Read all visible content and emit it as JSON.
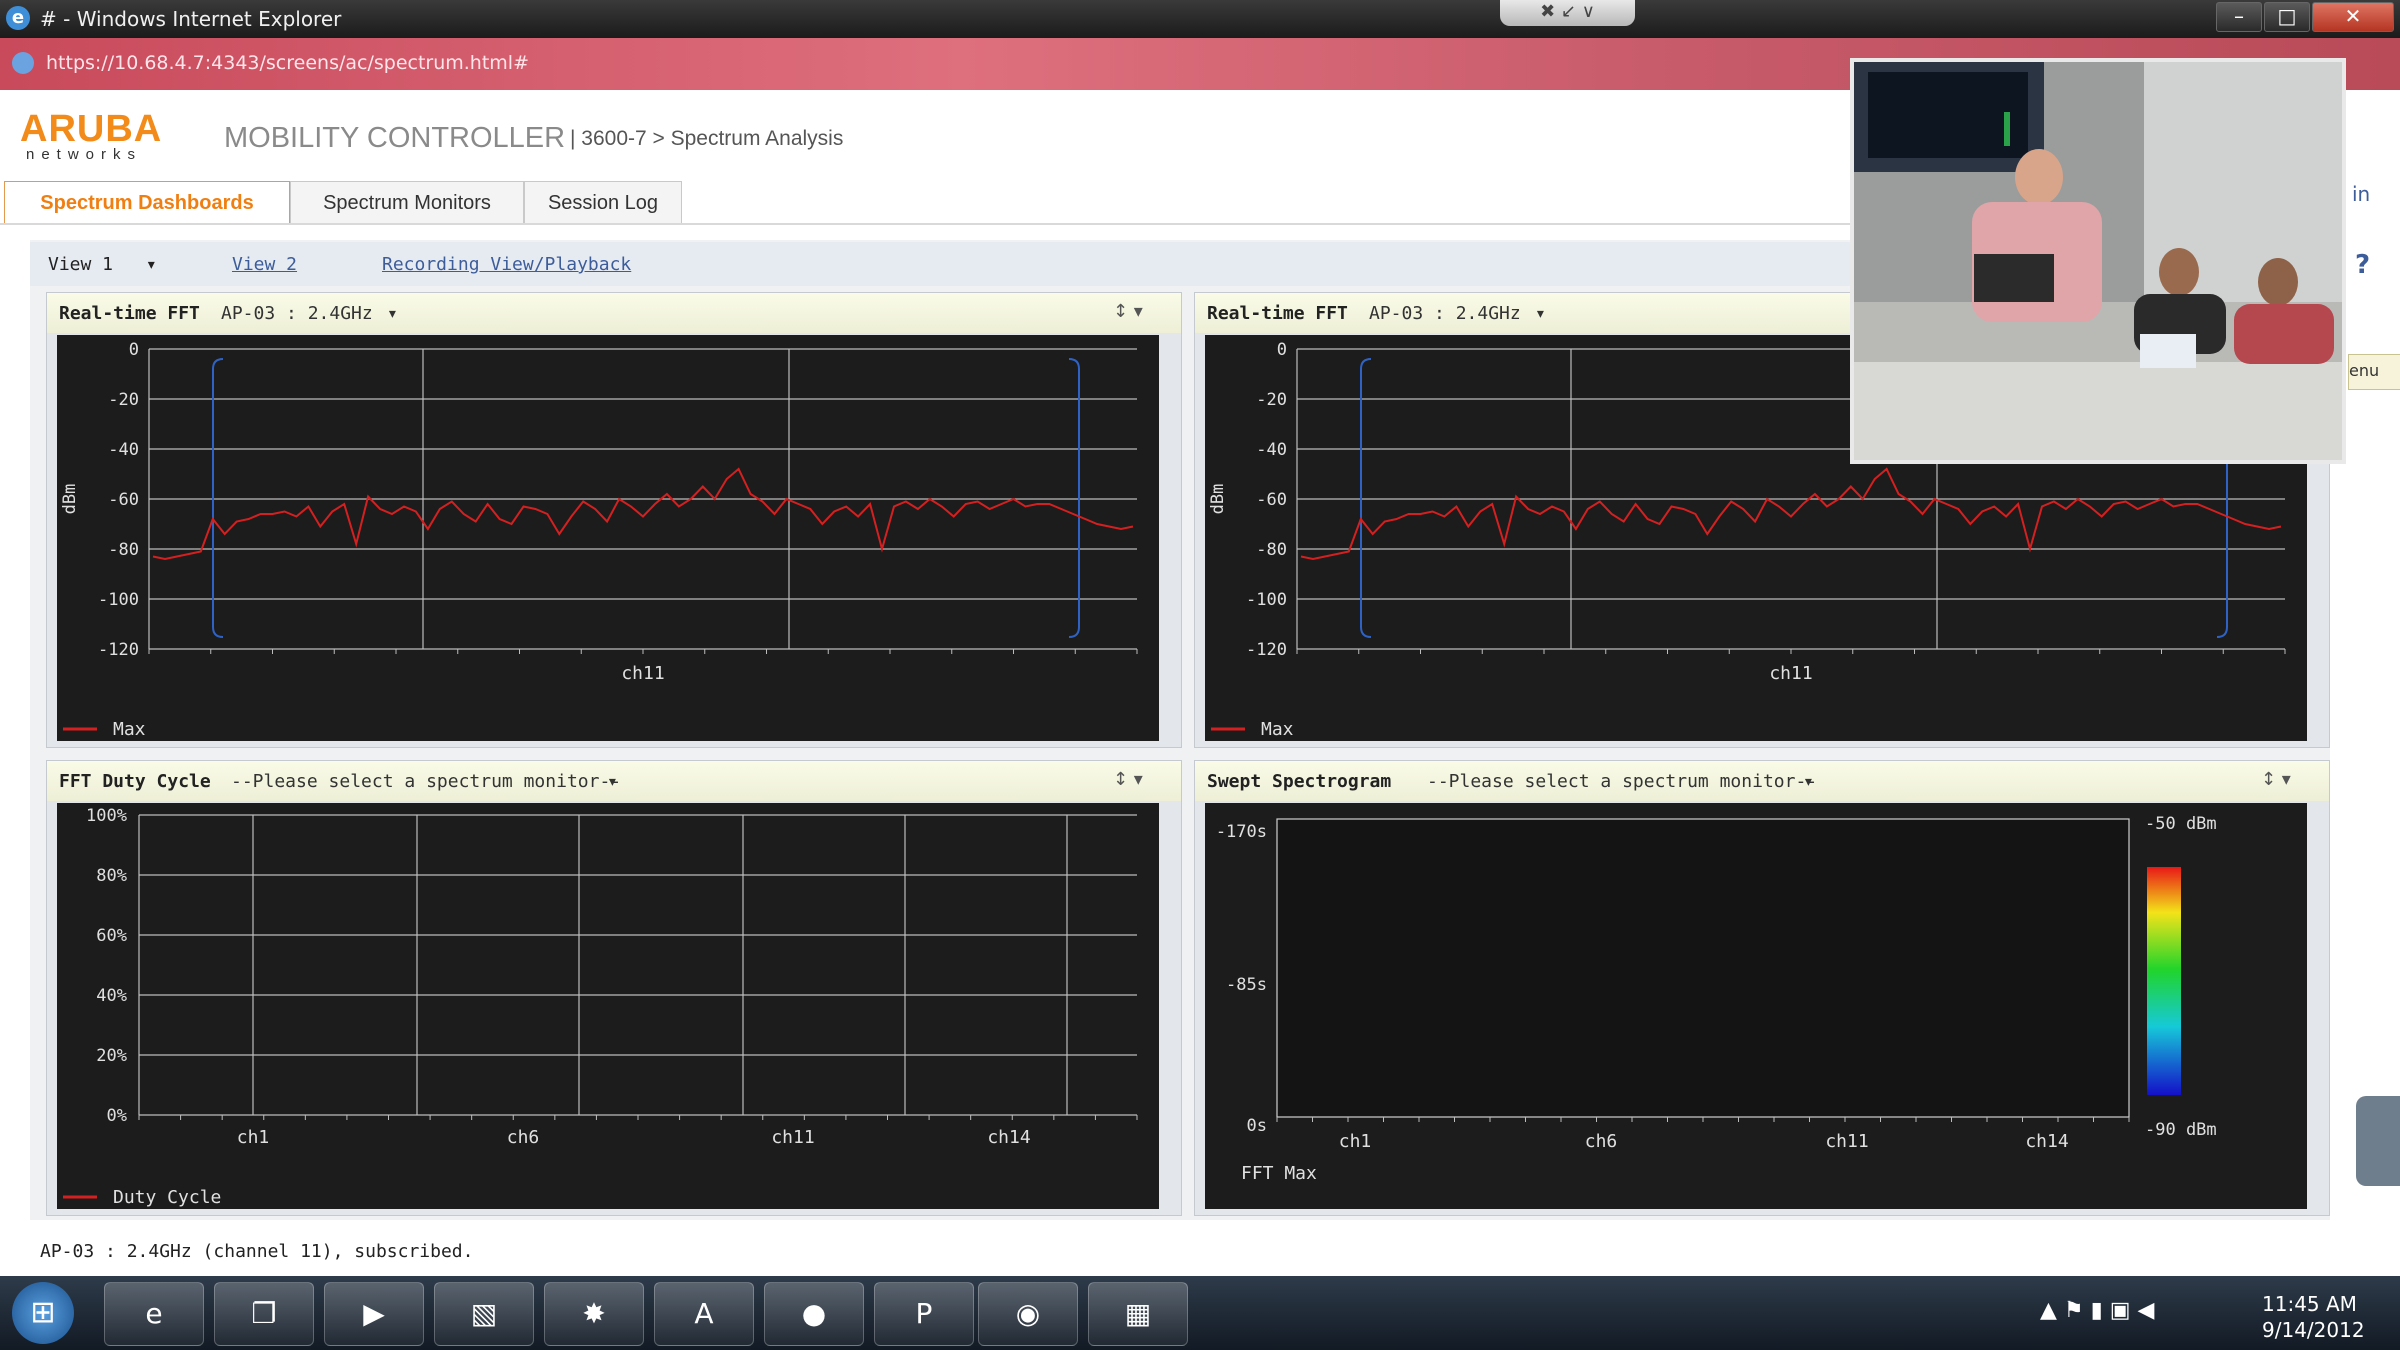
{
  "window": {
    "title": "# - Windows Internet Explorer",
    "minimize": "–",
    "maximize": "□",
    "close": "✕",
    "top_tab_icons": "✖ ↙ ∨"
  },
  "address": {
    "url": "https://10.68.4.7:4343/screens/ac/spectrum.html#"
  },
  "header": {
    "logo_main": "ARUBA",
    "logo_sub": "networks",
    "product": "MOBILITY CONTROLLER",
    "breadcrumb": "| 3600-7 > Spectrum Analysis"
  },
  "tabs": [
    {
      "label": "Spectrum Dashboards",
      "active": true
    },
    {
      "label": "Spectrum Monitors",
      "active": false
    },
    {
      "label": "Session Log",
      "active": false
    }
  ],
  "views": {
    "current": "View 1",
    "dropdown": "▾",
    "view2": "View 2",
    "recording": "Recording View/Playback",
    "help": "?"
  },
  "side": {
    "login_fragment": "in",
    "menu_fragment": "enu"
  },
  "panels": {
    "fft_left": {
      "title": "Real-time FFT",
      "monitor": "AP-03 : 2.4GHz",
      "dropdown": "▾",
      "ctrl": "↕  ▾"
    },
    "fft_right": {
      "title": "Real-time FFT",
      "monitor": "AP-03 : 2.4GHz",
      "dropdown": "▾",
      "ctrl": "↕  ▾"
    },
    "duty": {
      "title": "FFT Duty Cycle",
      "monitor": "--Please select a spectrum monitor--",
      "dropdown": "▾",
      "ctrl": "↕  ▾"
    },
    "spectro": {
      "title": "Swept Spectrogram",
      "monitor": "--Please select a spectrum monitor--",
      "dropdown": "▾",
      "ctrl": "↕  ▾"
    }
  },
  "chart_data": [
    {
      "type": "line",
      "ylabel": "dBm",
      "xlabel": "ch11",
      "ylim": [
        -120,
        0
      ],
      "y_ticks": [
        "0",
        "-20",
        "-40",
        "-60",
        "-80",
        "-100",
        "-120"
      ],
      "legend": "Max",
      "series": [
        {
          "name": "Max",
          "color": "#d42020",
          "values": [
            -83,
            -84,
            -83,
            -82,
            -81,
            -68,
            -74,
            -69,
            -68,
            -66,
            -66,
            -65,
            -67,
            -63,
            -71,
            -65,
            -62,
            -78,
            -59,
            -64,
            -66,
            -63,
            -65,
            -72,
            -64,
            -61,
            -66,
            -69,
            -62,
            -68,
            -70,
            -63,
            -64,
            -66,
            -74,
            -67,
            -61,
            -64,
            -69,
            -60,
            -63,
            -67,
            -62,
            -58,
            -63,
            -60,
            -55,
            -60,
            -52,
            -48,
            -58,
            -61,
            -66,
            -60,
            -62,
            -64,
            -70,
            -65,
            -63,
            -67,
            -62,
            -80,
            -63,
            -61,
            -64,
            -60,
            -63,
            -67,
            -62,
            -61,
            -64,
            -62,
            -60,
            -63,
            -62,
            -62,
            -64,
            -66,
            -68,
            -70,
            -71,
            -72,
            -71
          ]
        }
      ]
    },
    {
      "type": "line",
      "ylabel": "dBm",
      "xlabel": "ch11",
      "ylim": [
        -120,
        0
      ],
      "y_ticks": [
        "0",
        "-20",
        "-40",
        "-60",
        "-80",
        "-100",
        "-120"
      ],
      "legend": "Max",
      "series": [
        {
          "name": "Max",
          "color": "#d42020",
          "values": [
            -83,
            -84,
            -83,
            -82,
            -81,
            -68,
            -74,
            -69,
            -68,
            -66,
            -66,
            -65,
            -67,
            -63,
            -71,
            -65,
            -62,
            -78,
            -59,
            -64,
            -66,
            -63,
            -65,
            -72,
            -64,
            -61,
            -66,
            -69,
            -62,
            -68,
            -70,
            -63,
            -64,
            -66,
            -74,
            -67,
            -61,
            -64,
            -69,
            -60,
            -63,
            -67,
            -62,
            -58,
            -63,
            -60,
            -55,
            -60,
            -52,
            -48,
            -58,
            -61,
            -66,
            -60,
            -62,
            -64,
            -70,
            -65,
            -63,
            -67,
            -62,
            -80,
            -63,
            -61,
            -64,
            -60,
            -63,
            -67,
            -62,
            -61,
            -64,
            -62,
            -60,
            -63,
            -62,
            -62,
            -64,
            -66,
            -68,
            -70,
            -71,
            -72,
            -71
          ]
        }
      ]
    },
    {
      "type": "line",
      "ylim": [
        0,
        100
      ],
      "y_ticks": [
        "100%",
        "80%",
        "60%",
        "40%",
        "20%",
        "0%"
      ],
      "x_ticks": [
        "ch1",
        "ch6",
        "ch11",
        "ch14"
      ],
      "legend": "Duty Cycle",
      "series": [
        {
          "name": "Duty Cycle",
          "color": "#d42020",
          "values": []
        }
      ]
    },
    {
      "type": "heatmap",
      "y_ticks": [
        "-170s",
        "-85s",
        "0s"
      ],
      "x_ticks": [
        "ch1",
        "ch6",
        "ch11",
        "ch14"
      ],
      "scale_labels": [
        "-50 dBm",
        "-90 dBm"
      ],
      "footer": "FFT Max",
      "values": []
    }
  ],
  "status": "AP-03 : 2.4GHz (channel 11), subscribed.",
  "taskbar": {
    "start": "⊞",
    "apps": [
      "e",
      "❐",
      "▶",
      "▧",
      "✸",
      "A",
      "●",
      "P",
      "◉",
      "▦"
    ],
    "time": "11:45 AM",
    "date": "9/14/2012",
    "tray": "▲  ⚑  ▮  ▣  ◀"
  }
}
